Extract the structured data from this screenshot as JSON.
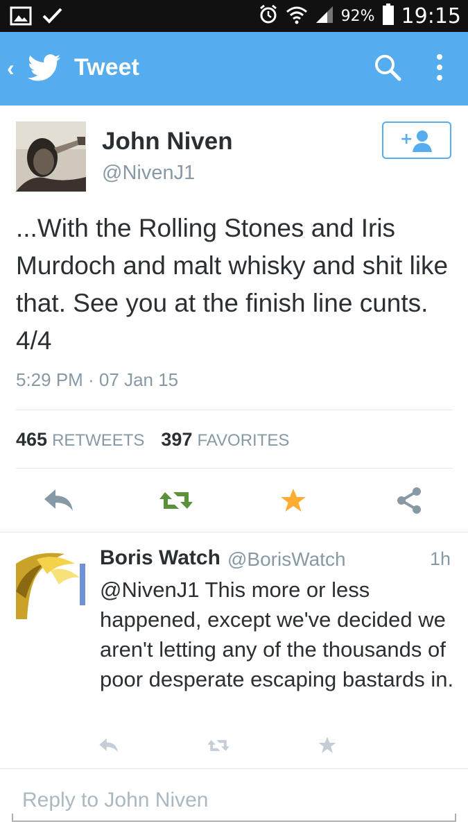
{
  "status_bar": {
    "battery_percent": "92%",
    "time": "19:15",
    "icons": [
      "image-icon",
      "check-icon",
      "alarm-icon",
      "wifi-icon",
      "signal-icon",
      "battery-icon"
    ]
  },
  "app_bar": {
    "title": "Tweet",
    "color": "#55acee",
    "icons": [
      "back-chevron-icon",
      "twitter-bird-icon",
      "search-icon",
      "overflow-menu-icon"
    ]
  },
  "tweet": {
    "author_name": "John Niven",
    "author_handle": "@NivenJ1",
    "text": "...With the Rolling Stones and Iris Murdoch and malt whisky and shit like that. See you at the finish line cunts. 4/4",
    "timestamp": "5:29 PM · 07 Jan 15",
    "retweets_count": "465",
    "retweets_label": "RETWEETS",
    "favorites_count": "397",
    "favorites_label": "FAVORITES",
    "favorited": true,
    "action_colors": {
      "reply": "#8899a6",
      "retweet": "#5c913b",
      "favorite": "#ffac33",
      "share": "#8899a6"
    }
  },
  "reply": {
    "author_name": "Boris Watch",
    "author_handle": "@BorisWatch",
    "time": "1h",
    "text": "@NivenJ1 This more or less happened, except we've decided we aren't letting any of the thousands of poor desperate escaping bastards in."
  },
  "compose": {
    "placeholder": "Reply to John Niven"
  }
}
